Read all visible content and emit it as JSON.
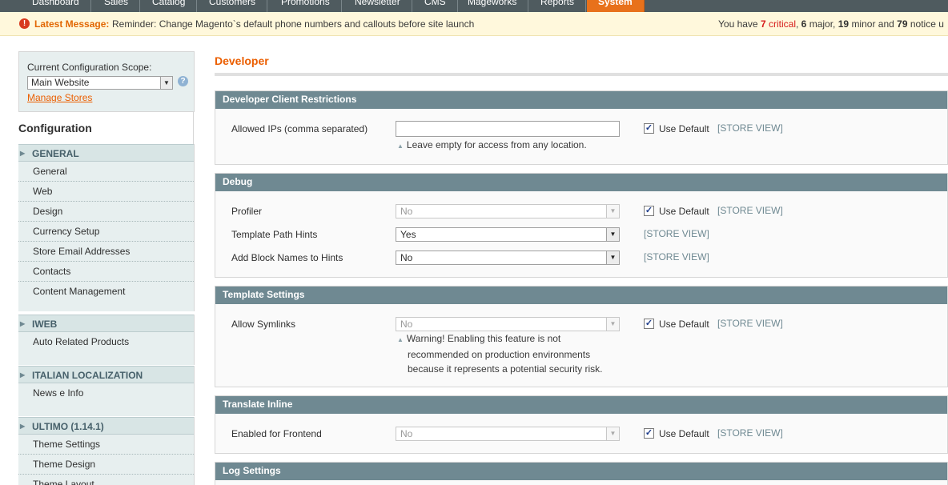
{
  "topnav": {
    "items": [
      "Dashboard",
      "Sales",
      "Catalog",
      "Customers",
      "Promotions",
      "Newsletter",
      "CMS",
      "Mageworks",
      "Reports",
      "System"
    ]
  },
  "message": {
    "icon": "alert-icon",
    "latest_label": "Latest Message:",
    "text": "Reminder: Change Magento`s default phone numbers and callouts before site launch",
    "counts_prefix": "You have",
    "critical_count": "7",
    "critical_label": "critical",
    "major_count": "6",
    "major_label": "major,",
    "minor_count": "19",
    "minor_label": "minor and",
    "notice_count": "79",
    "notice_label": "notice u"
  },
  "sidebar": {
    "scope_label": "Current Configuration Scope:",
    "scope_value": "Main Website",
    "manage_stores": "Manage Stores",
    "config_title": "Configuration",
    "groups": [
      {
        "head": "GENERAL",
        "links": [
          "General",
          "Web",
          "Design",
          "Currency Setup",
          "Store Email Addresses",
          "Contacts",
          "Content Management"
        ]
      },
      {
        "head": "IWEB",
        "links": [
          "Auto Related Products"
        ]
      },
      {
        "head": "ITALIAN LOCALIZATION",
        "links": [
          "News e Info"
        ]
      },
      {
        "head": "ULTIMO (1.14.1)",
        "links": [
          "Theme Settings",
          "Theme Design",
          "Theme Layout"
        ]
      }
    ]
  },
  "main": {
    "page_title": "Developer",
    "use_default": "Use Default",
    "store_view": "[STORE VIEW]",
    "sections": {
      "client": {
        "head": "Developer Client Restrictions",
        "allowed_ips_label": "Allowed IPs (comma separated)",
        "allowed_ips_value": "",
        "note": "Leave empty for access from any location."
      },
      "debug": {
        "head": "Debug",
        "profiler_label": "Profiler",
        "profiler_value": "No",
        "path_hints_label": "Template Path Hints",
        "path_hints_value": "Yes",
        "block_names_label": "Add Block Names to Hints",
        "block_names_value": "No"
      },
      "template": {
        "head": "Template Settings",
        "symlinks_label": "Allow Symlinks",
        "symlinks_value": "No",
        "warning_line1": "Warning! Enabling this feature is not",
        "warning_line2": "recommended on production environments",
        "warning_line3": "because it represents a potential security risk."
      },
      "translate": {
        "head": "Translate Inline",
        "frontend_label": "Enabled for Frontend",
        "frontend_value": "No"
      },
      "log": {
        "head": "Log Settings"
      }
    }
  }
}
